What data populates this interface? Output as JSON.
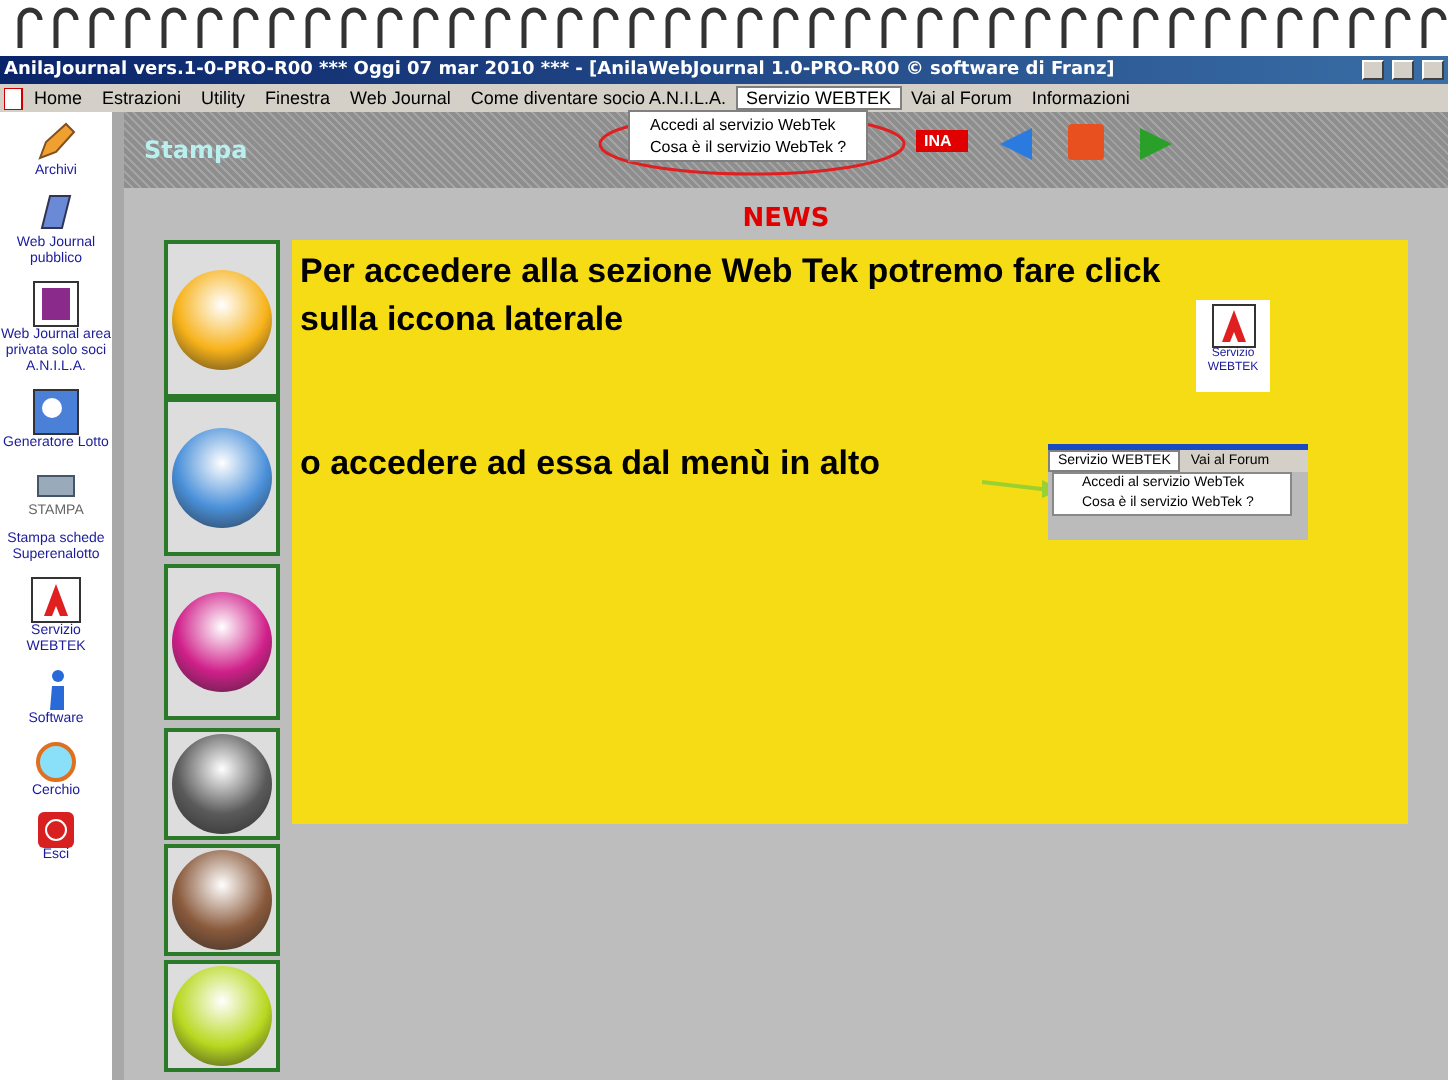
{
  "window": {
    "title": "AnilaJournal vers.1-0-PRO-R00  ***  Oggi 07 mar 2010  ***  - [AnilaWebJournal 1.0-PRO-R00    © software di Franz]"
  },
  "menu": [
    {
      "label": "Home",
      "open": false
    },
    {
      "label": "Estrazioni",
      "open": false
    },
    {
      "label": "Utility",
      "open": false
    },
    {
      "label": "Finestra",
      "open": false
    },
    {
      "label": "Web Journal",
      "open": false
    },
    {
      "label": "Come diventare socio A.N.I.L.A.",
      "open": false
    },
    {
      "label": "Servizio WEBTEK",
      "open": true
    },
    {
      "label": "Vai al Forum",
      "open": false
    },
    {
      "label": "Informazioni",
      "open": false
    }
  ],
  "dropdown": [
    "Accedi al servizio WebTek",
    "Cosa è il servizio WebTek ?"
  ],
  "toolbar": {
    "title": "Stampa",
    "tag": "INA"
  },
  "sidebar": [
    {
      "label": "Archivi",
      "kind": "pencil"
    },
    {
      "label": "Web Journal pubblico",
      "kind": "journal"
    },
    {
      "label": "Web Journal area privata solo soci A.N.I.L.A.",
      "kind": "book"
    },
    {
      "label": "Generatore Lotto",
      "kind": "generator"
    },
    {
      "label": "STAMPA",
      "kind": "printer"
    },
    {
      "label": "Stampa schede Superenalotto",
      "kind": "text"
    },
    {
      "label": "Servizio WEBTEK",
      "kind": "webtek"
    },
    {
      "label": "Software",
      "kind": "info"
    },
    {
      "label": "Cerchio",
      "kind": "circle"
    },
    {
      "label": "Esci",
      "kind": "exit"
    }
  ],
  "news": {
    "heading": "NEWS",
    "text_1": "Per accedere alla sezione Web Tek potremo fare click sulla iccona laterale",
    "icon_label": "Servizio WEBTEK",
    "text_2": "o accedere ad essa dal menù in alto",
    "inset": {
      "menu": [
        "Servizio WEBTEK",
        "Vai al Forum"
      ],
      "items": [
        "Accedi al servizio WebTek",
        "Cosa è il servizio WebTek ?"
      ]
    }
  },
  "orbs": [
    {
      "color": "#f7b21a"
    },
    {
      "color": "#4a90d9"
    },
    {
      "color": "#d0208a"
    },
    {
      "color": "#5a5a5a"
    },
    {
      "color": "#8a5a3c"
    },
    {
      "color": "#b8d820"
    }
  ]
}
